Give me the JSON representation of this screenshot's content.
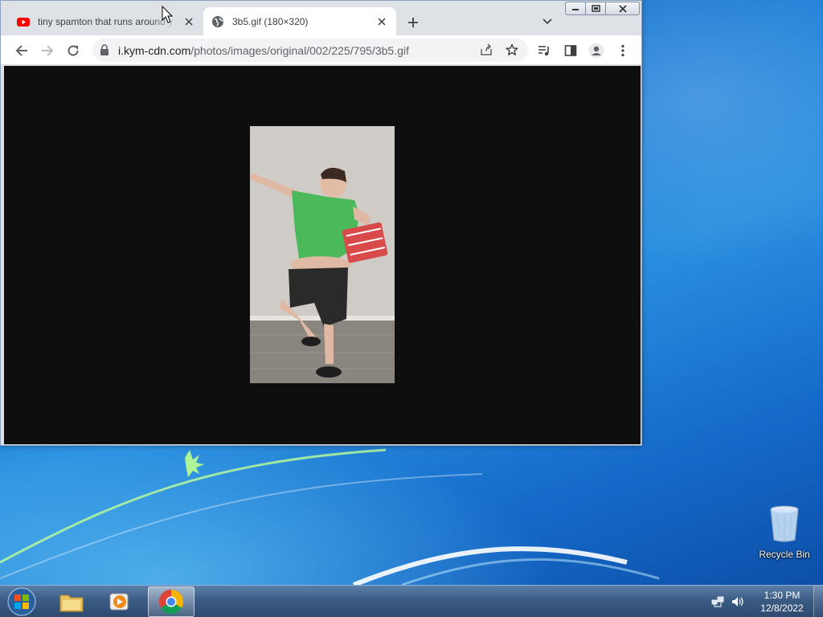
{
  "browser": {
    "tabs": [
      {
        "title": "tiny spamton that runs around y",
        "favicon": "youtube-icon",
        "active": false
      },
      {
        "title": "3b5.gif (180×320)",
        "favicon": "globe-icon",
        "active": true
      }
    ],
    "address": {
      "host": "i.kym-cdn.com",
      "path": "/photos/images/original/002/225/795/3b5.gif"
    }
  },
  "desktop": {
    "icons": [
      {
        "label": "Recycle Bin",
        "icon": "recycle-bin-icon"
      }
    ]
  },
  "taskbar": {
    "items": [
      "start-orb",
      "file-explorer-icon",
      "media-player-icon",
      "chrome-icon"
    ],
    "clock": {
      "time": "1:30 PM",
      "date": "12/8/2022"
    }
  },
  "colors": {
    "page_background": "#0e0e0e",
    "tabstrip": "#dee1e6",
    "shirt": "#4bb85a"
  }
}
